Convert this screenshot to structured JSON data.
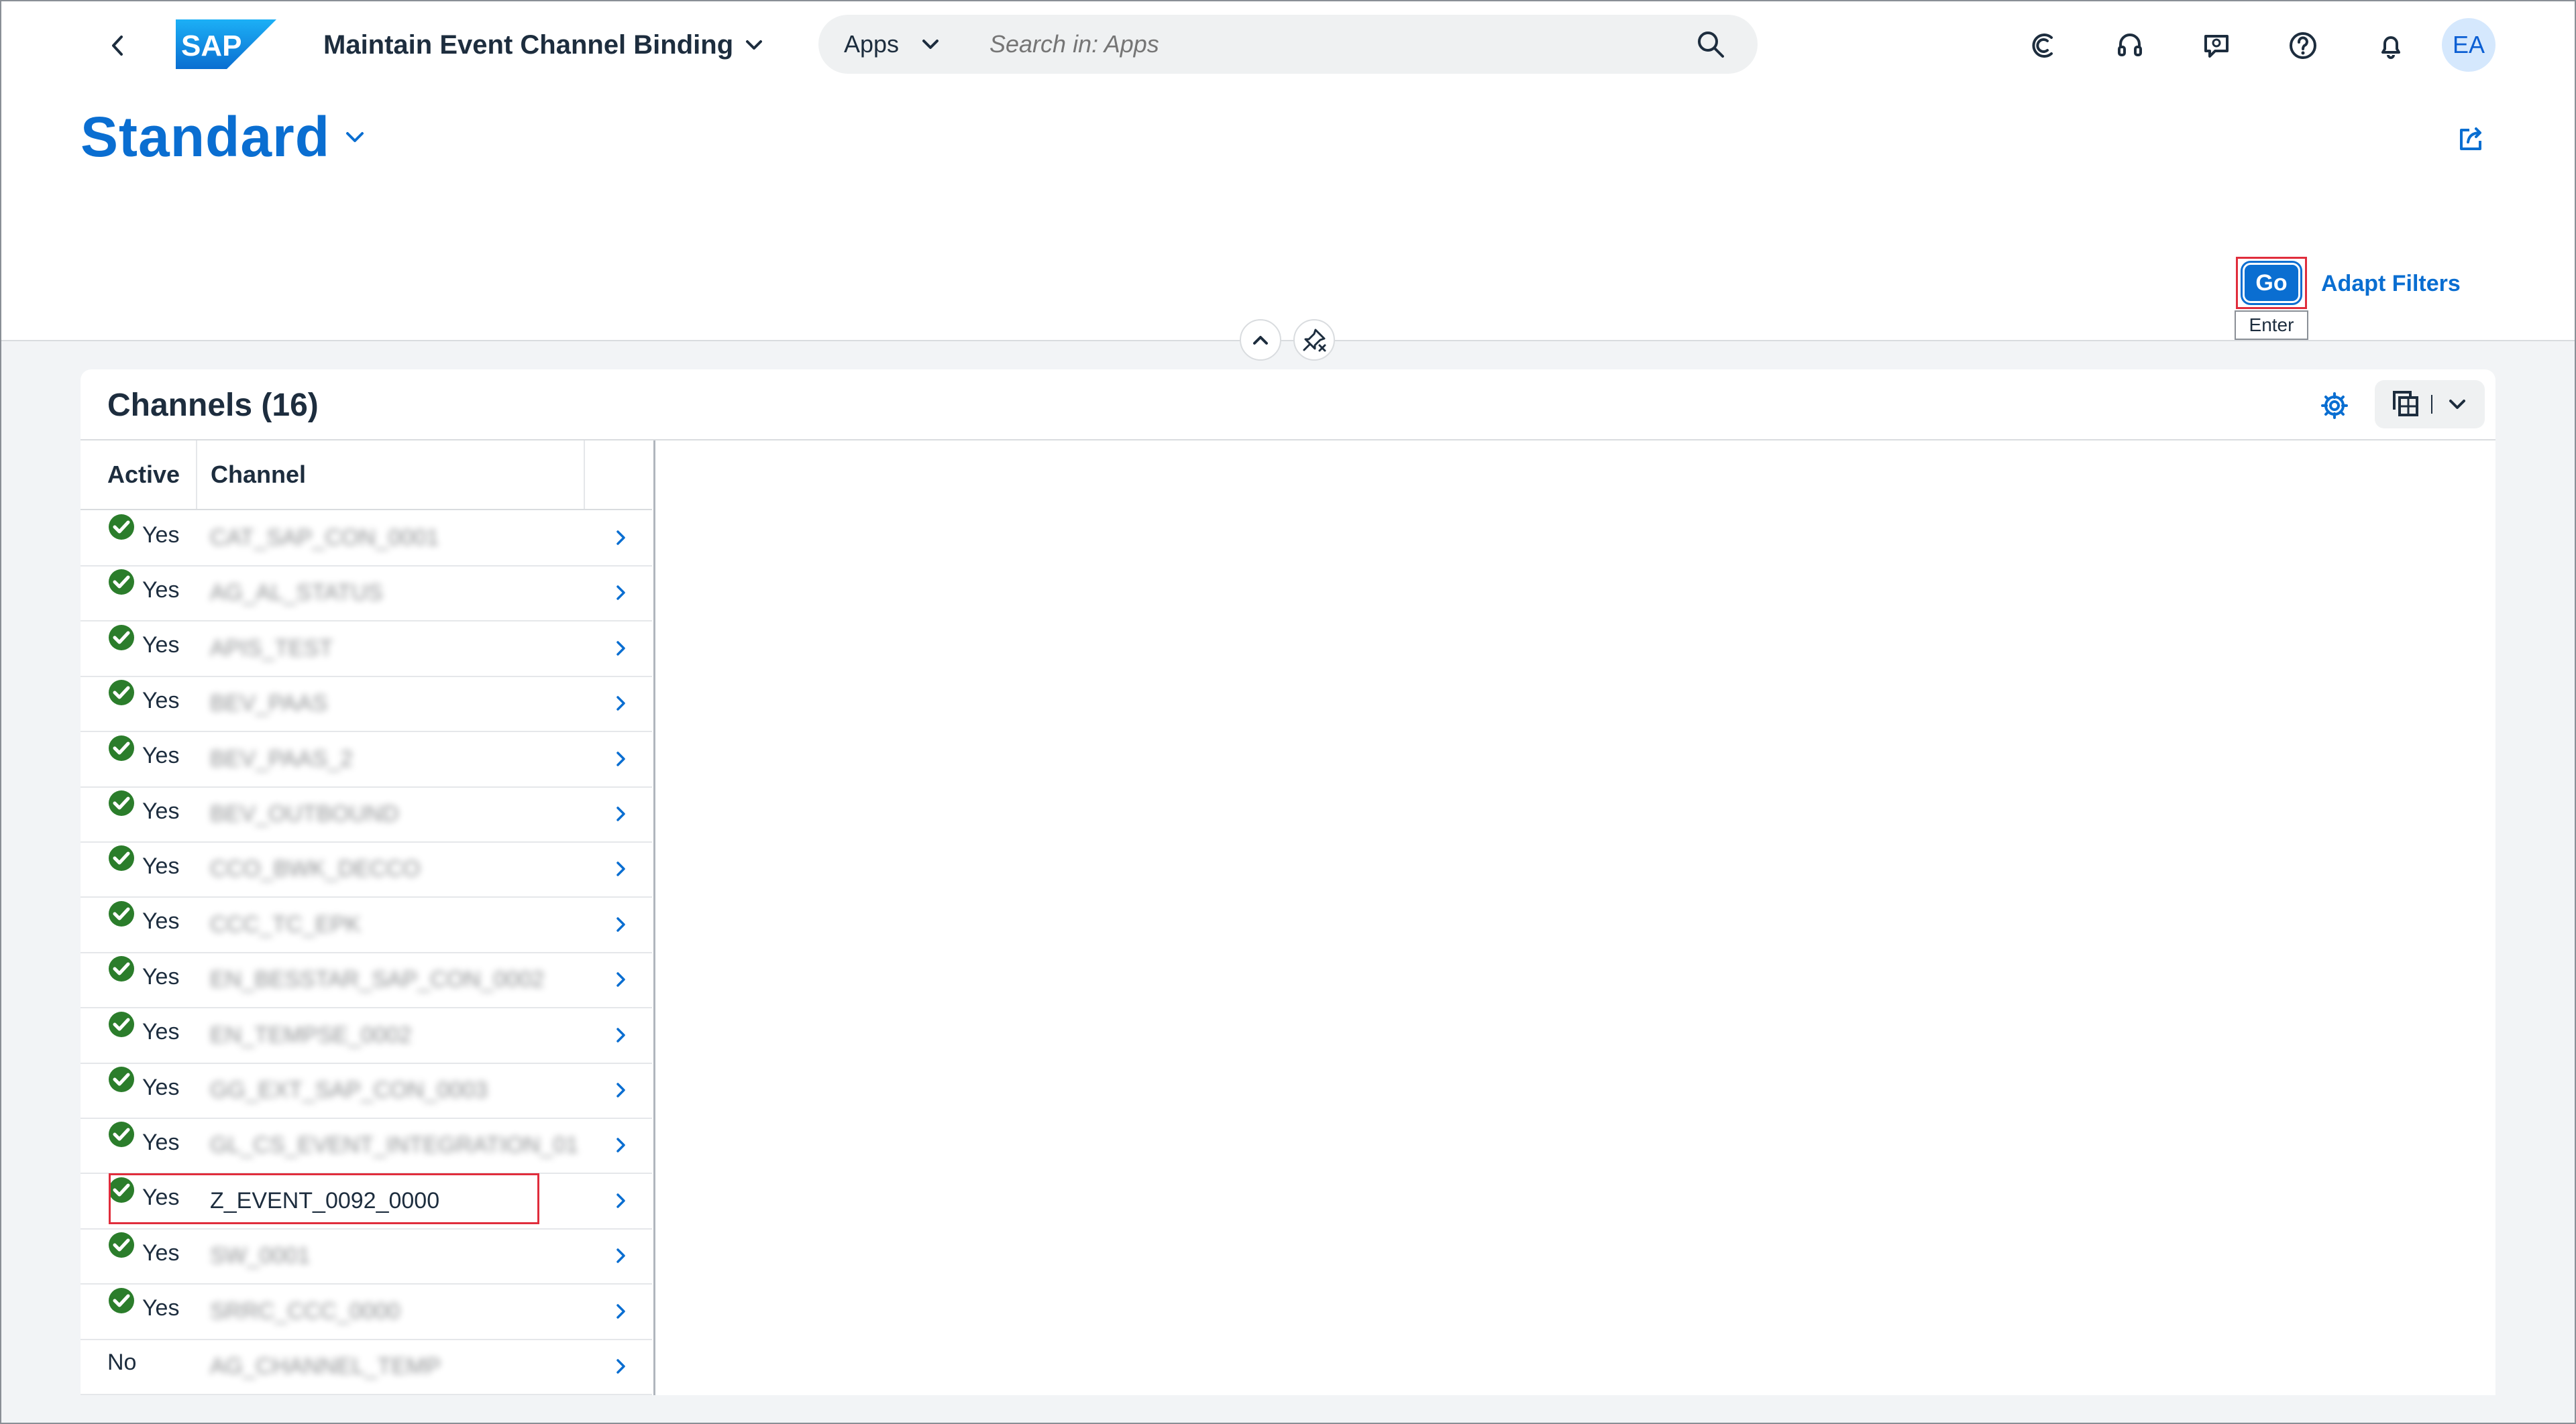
{
  "shell": {
    "app_title": "Maintain Event Channel Binding",
    "logo_text": "SAP",
    "search_scope": "Apps",
    "search_placeholder": "Search in: Apps",
    "avatar_initials": "EA",
    "icons": [
      "back-icon",
      "joule-icon",
      "support-headset-icon",
      "feedback-icon",
      "help-icon",
      "notifications-bell-icon",
      "search-icon"
    ]
  },
  "header": {
    "variant_title": "Standard",
    "go_label": "Go",
    "adapt_filters_label": "Adapt Filters",
    "tooltip": "Enter"
  },
  "table": {
    "title": "Channels (16)",
    "columns": [
      "Active",
      "Channel"
    ],
    "rows": [
      {
        "active": "Yes",
        "channel": "CAT_SAP_CON_0001"
      },
      {
        "active": "Yes",
        "channel": "AG_AL_STATUS"
      },
      {
        "active": "Yes",
        "channel": "APIS_TEST"
      },
      {
        "active": "Yes",
        "channel": "BEV_PAAS"
      },
      {
        "active": "Yes",
        "channel": "BEV_PAAS_2"
      },
      {
        "active": "Yes",
        "channel": "BEV_OUTBOUND"
      },
      {
        "active": "Yes",
        "channel": "CCO_BWK_DECCO"
      },
      {
        "active": "Yes",
        "channel": "CCC_TC_EPK"
      },
      {
        "active": "Yes",
        "channel": "EN_BESSTAR_SAP_CON_0002"
      },
      {
        "active": "Yes",
        "channel": "EN_TEMPSE_0002"
      },
      {
        "active": "Yes",
        "channel": "GG_EXT_SAP_CON_0003"
      },
      {
        "active": "Yes",
        "channel": "GL_CS_EVENT_INTEGRATION_01"
      },
      {
        "active": "Yes",
        "channel": "Z_EVENT_0092_0000"
      },
      {
        "active": "Yes",
        "channel": "SW_0001"
      },
      {
        "active": "Yes",
        "channel": "SRRC_CCC_0000"
      },
      {
        "active": "No",
        "channel": "AG_CHANNEL_TEMP"
      }
    ]
  },
  "colors": {
    "brand_blue": "#0a6ed1",
    "positive_green": "#2b7d2b",
    "highlight_red": "#e02d3c"
  }
}
